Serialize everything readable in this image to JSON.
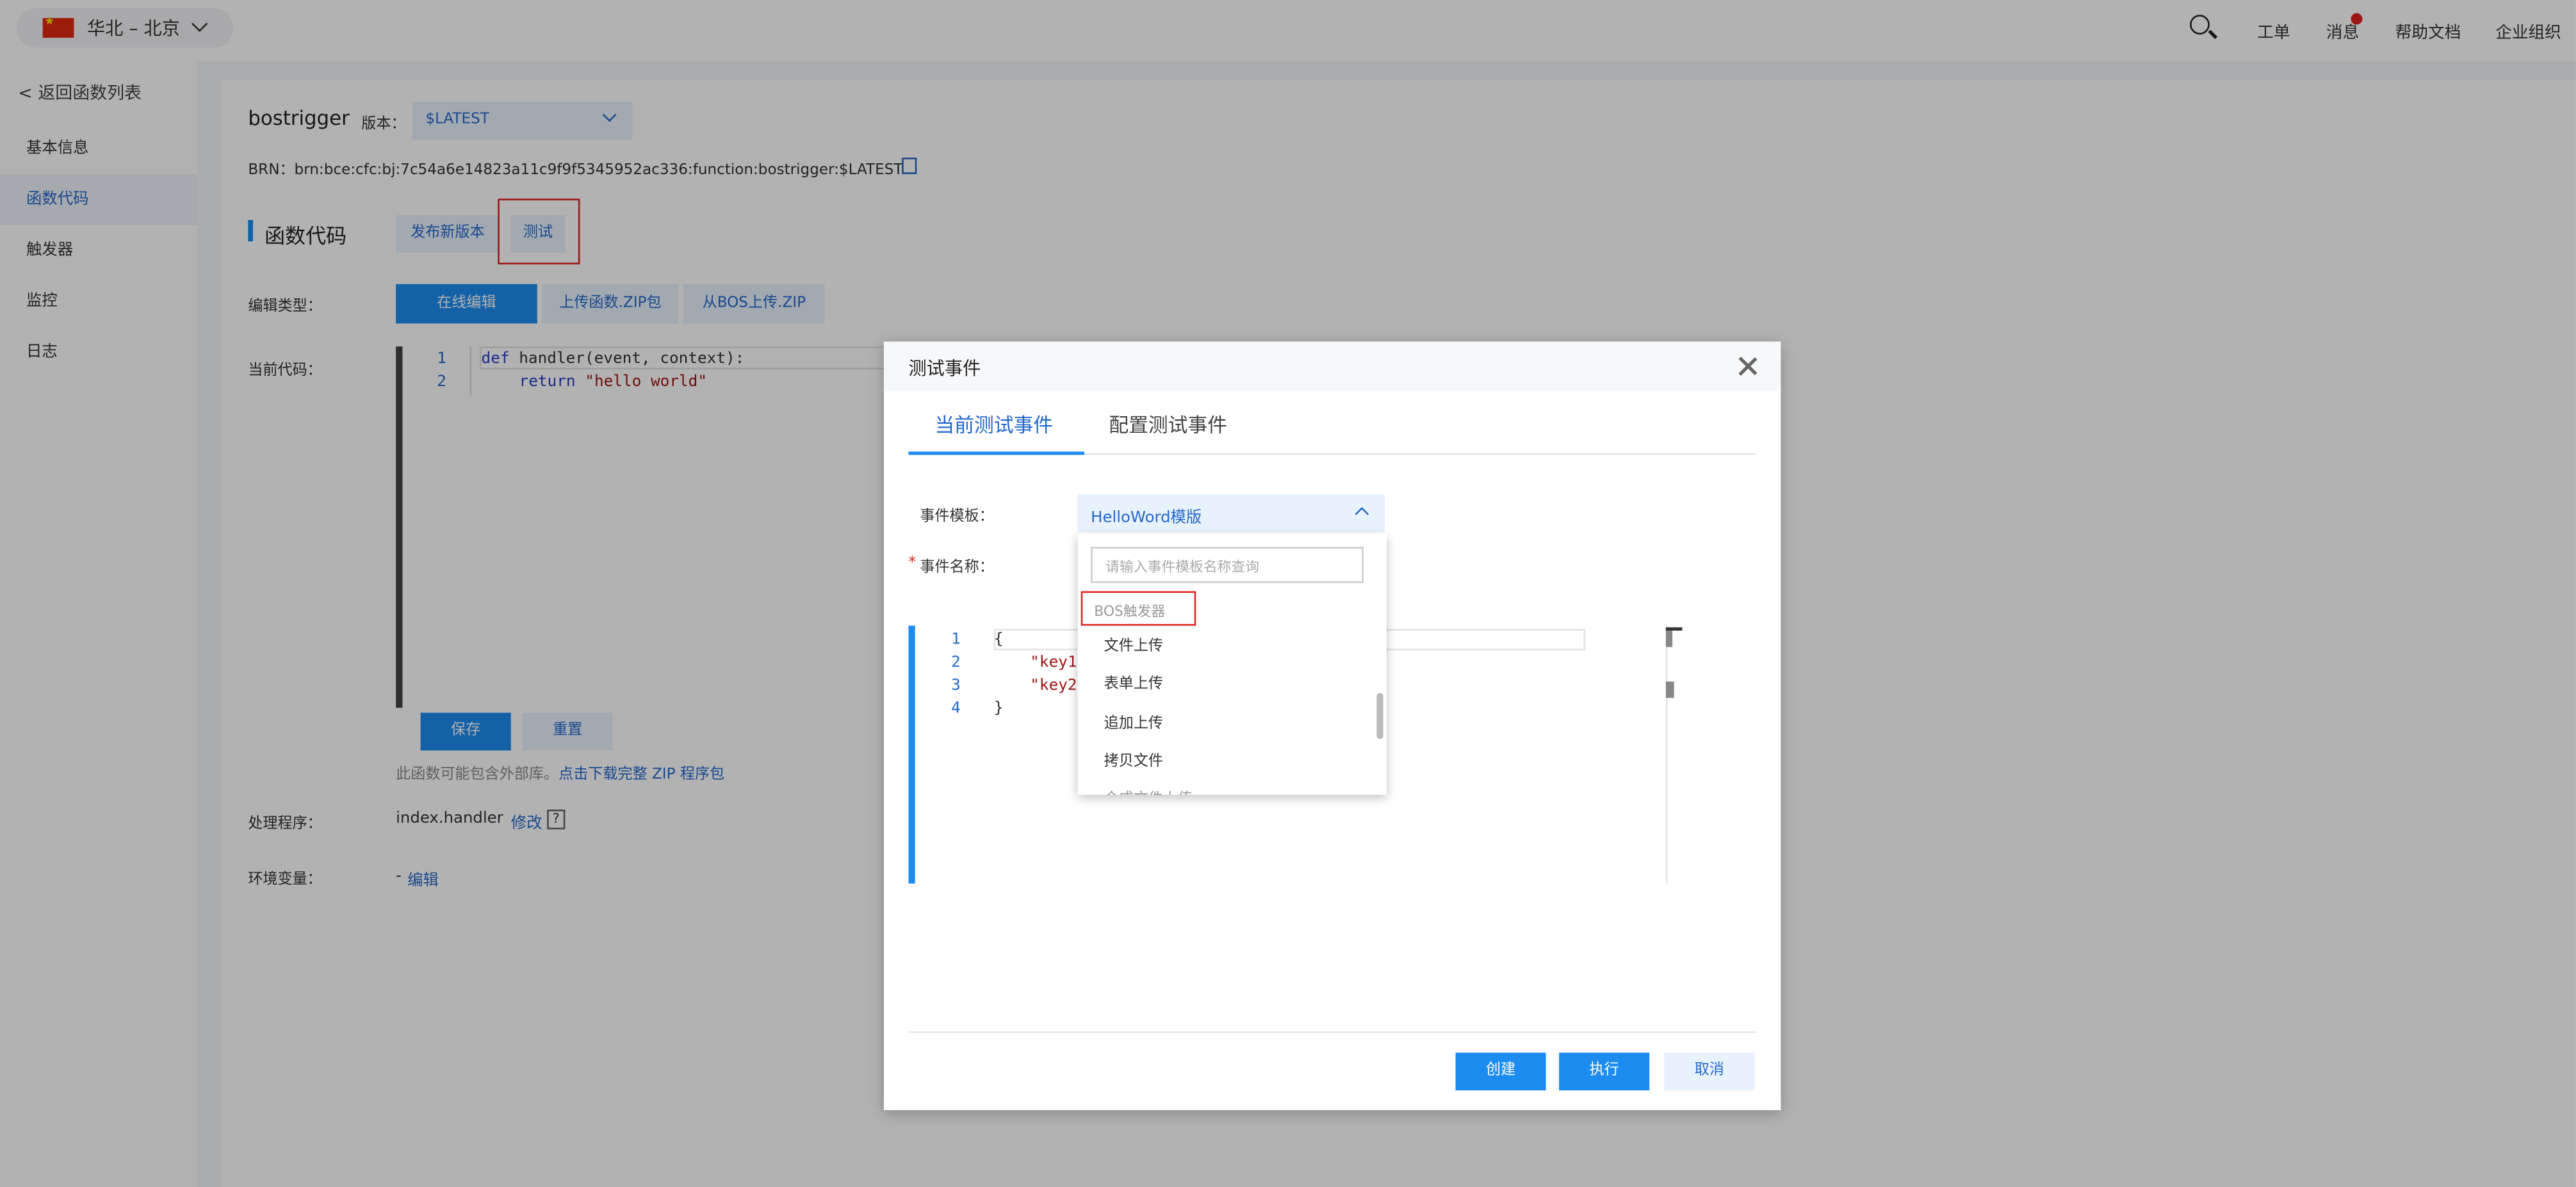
{
  "topbar": {
    "region": "华北 – 北京",
    "links": [
      "工单",
      "消息",
      "帮助文档",
      "企业组织"
    ]
  },
  "sidebar": {
    "back": "< 返回函数列表",
    "items": [
      "基本信息",
      "函数代码",
      "触发器",
      "监控",
      "日志"
    ]
  },
  "function": {
    "name": "bostrigger",
    "version_label": "版本：",
    "version_value": "$LATEST",
    "brn": "BRN：brn:bce:cfc:bj:7c54a6e14823a11c9f9f5345952ac336:function:bostrigger:$LATEST"
  },
  "code_section": {
    "title": "函数代码",
    "publish": "发布新版本",
    "test": "测试",
    "edit_type_label": "编辑类型：",
    "edit_types": [
      "在线编辑",
      "上传函数.ZIP包",
      "从BOS上传.ZIP"
    ],
    "current_label": "当前代码：",
    "line_numbers": [
      "1",
      "2"
    ],
    "line1_kw": "def",
    "line1_rest": " handler(event, context):",
    "line2_kw": "return",
    "line2_str": "\"hello world\"",
    "save": "保存",
    "reset": "重置",
    "hint": "此函数可能包含外部库。",
    "download": "点击下载完整 ZIP 程序包",
    "handler_label": "处理程序：",
    "handler_value": "index.handler",
    "modify": "修改",
    "help": "?",
    "env_label": "环境变量：",
    "env_dash": "-",
    "env_edit": "编辑"
  },
  "modal": {
    "title": "测试事件",
    "tabs": [
      "当前测试事件",
      "配置测试事件"
    ],
    "template_label": "事件模板：",
    "template_value": "HelloWord模版",
    "name_label": "事件名称：",
    "required_mark": "*",
    "search_placeholder": "请输入事件模板名称查询",
    "group": "BOS触发器",
    "options": [
      "文件上传",
      "表单上传",
      "追加上传",
      "拷贝文件",
      "合成文件上传"
    ],
    "line_numbers": [
      "1",
      "2",
      "3",
      "4"
    ],
    "json_open": "{",
    "json_key1": "\"key1",
    "json_key2": "\"key2",
    "json_close": "}",
    "buttons": {
      "create": "创建",
      "execute": "执行",
      "cancel": "取消"
    }
  }
}
